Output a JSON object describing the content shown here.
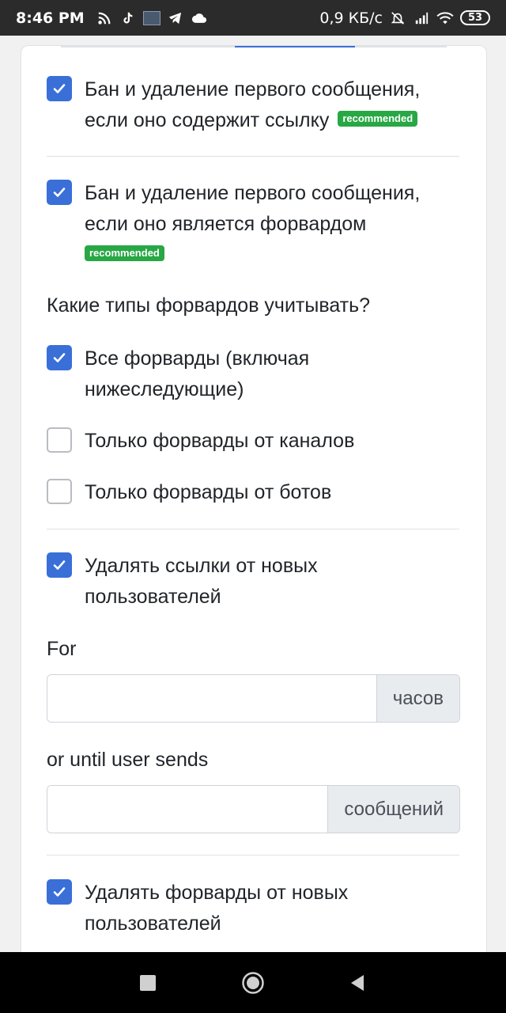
{
  "status_bar": {
    "time": "8:46 PM",
    "left_icons": [
      "rss-icon",
      "tiktok-icon",
      "image-thumbnail-icon",
      "telegram-icon",
      "cloud-icon"
    ],
    "network_speed": "0,9 КБ/с",
    "right_icons": [
      "bell-off-icon",
      "signal-icon",
      "wifi-icon"
    ],
    "battery": "53"
  },
  "settings": {
    "ban_link": {
      "label": "Бан и удаление первого сообщения, если оно содержит ссылку",
      "badge": "recommended",
      "checked": true
    },
    "ban_forward": {
      "label": "Бан и удаление первого сообщения, если оно является форвардом",
      "badge": "recommended",
      "checked": true
    },
    "forward_types_question": "Какие типы форвардов учитывать?",
    "forward_all": {
      "label": "Все форварды (включая нижеследующие)",
      "checked": true
    },
    "forward_channels": {
      "label": "Только форварды от каналов",
      "checked": false
    },
    "forward_bots": {
      "label": "Только форварды от ботов",
      "checked": false
    },
    "delete_links_new": {
      "label": "Удалять ссылки от новых пользователей",
      "checked": true
    },
    "for_label": "For",
    "hours_input": {
      "value": "",
      "addon": "часов"
    },
    "until_label": "or until user sends",
    "messages_input": {
      "value": "",
      "addon": "сообщений"
    },
    "delete_forwards_new": {
      "label": "Удалять форварды от новых пользователей",
      "checked": true
    }
  },
  "colors": {
    "accent": "#3a6fd8",
    "badge_green": "#28a745"
  }
}
